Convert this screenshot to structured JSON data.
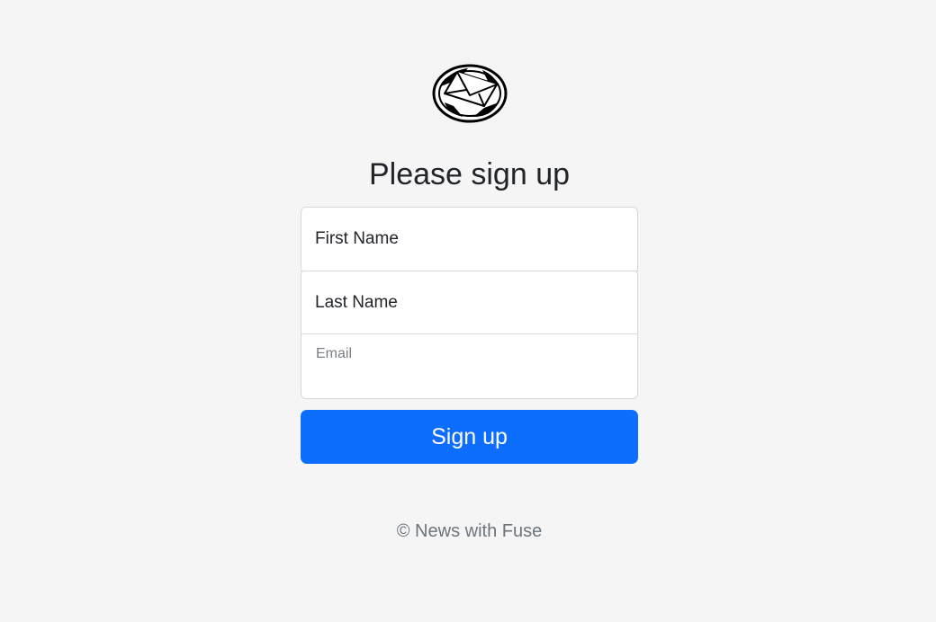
{
  "logo": {
    "icon": "envelope-icon"
  },
  "heading": {
    "title": "Please sign up"
  },
  "form": {
    "first_name_label": "First Name",
    "last_name_label": "Last Name",
    "email_label": "Email",
    "submit_label": "Sign up"
  },
  "footer": {
    "text": "© News with Fuse"
  },
  "colors": {
    "background": "#f5f5f5",
    "primary_button": "#0d6efd",
    "footer_text": "#6c757d"
  }
}
